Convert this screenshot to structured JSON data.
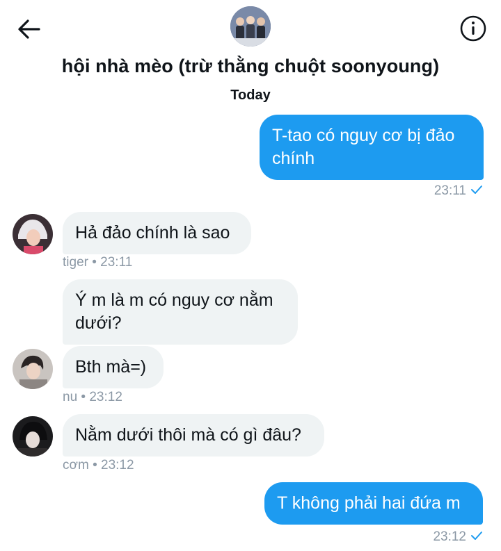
{
  "header": {
    "title": "hội nhà mèo (trừ thằng chuột soonyoung)"
  },
  "date_separator": "Today",
  "messages": [
    {
      "direction": "out",
      "text": "T-tao có nguy cơ bị đảo chính",
      "time": "23:11",
      "read": true
    },
    {
      "direction": "in",
      "text": "Hả đảo chính là sao",
      "sender": "tiger",
      "time": "23:11"
    },
    {
      "direction": "in",
      "text": "Ý m là m có nguy cơ nằm dưới?"
    },
    {
      "direction": "in",
      "text": "Bth mà=)",
      "sender": "nu",
      "time": "23:12"
    },
    {
      "direction": "in",
      "text": "Nằm dưới thôi mà có gì đâu?",
      "sender": "cơm",
      "time": "23:12"
    },
    {
      "direction": "out",
      "text": "T không phải hai đứa m",
      "time": "23:12",
      "read": true
    }
  ],
  "meta": {
    "m0": "23:11",
    "m1": "tiger • 23:11",
    "m3": "nu • 23:12",
    "m4": "cơm • 23:12",
    "m5": "23:12"
  },
  "colors": {
    "accent": "#1d9bf0",
    "incoming_bubble": "#eff3f4",
    "meta_text": "#8b98a5"
  },
  "icons": {
    "back": "arrow-left-icon",
    "info": "info-icon",
    "read": "check-icon"
  }
}
